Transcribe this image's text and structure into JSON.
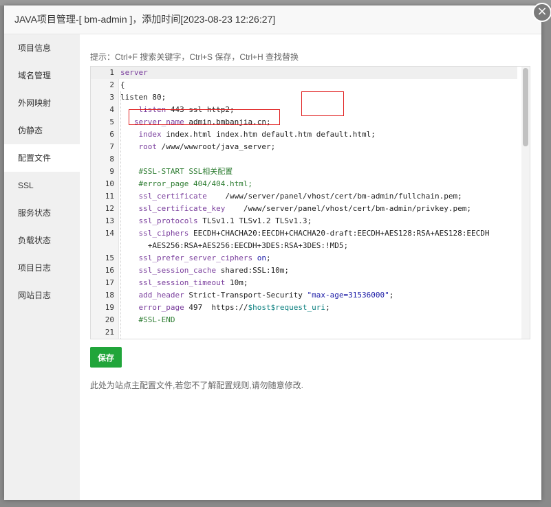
{
  "dialog": {
    "title": "JAVA项目管理-[ bm-admin ]，添加时间[2023-08-23 12:26:27]",
    "close_glyph": "×"
  },
  "sidebar": {
    "items": [
      {
        "label": "项目信息"
      },
      {
        "label": "域名管理"
      },
      {
        "label": "外网映射"
      },
      {
        "label": "伪静态"
      },
      {
        "label": "配置文件"
      },
      {
        "label": "SSL"
      },
      {
        "label": "服务状态"
      },
      {
        "label": "负载状态"
      },
      {
        "label": "项目日志"
      },
      {
        "label": "网站日志"
      }
    ],
    "active": "配置文件"
  },
  "main": {
    "hint": "提示：Ctrl+F 搜索关键字，Ctrl+S 保存，Ctrl+H 查找替换",
    "save_label": "保存",
    "note": "此处为站点主配置文件,若您不了解配置规则,请勿随意修改."
  },
  "editor": {
    "lines": [
      {
        "n": "1",
        "text": "server"
      },
      {
        "n": "2",
        "text": "{"
      },
      {
        "n": "3",
        "text": "listen 80;"
      },
      {
        "n": "4",
        "text": "    listen 443 ssl http2;"
      },
      {
        "n": "5",
        "text": "   server_name admin.bmbanjia.cn;"
      },
      {
        "n": "6",
        "text": "    index index.html index.htm default.htm default.html;"
      },
      {
        "n": "7",
        "text": "    root /www/wwwroot/java_server;"
      },
      {
        "n": "8",
        "text": ""
      },
      {
        "n": "9",
        "text": "    #SSL-START SSL相关配置"
      },
      {
        "n": "10",
        "text": "    #error_page 404/404.html;"
      },
      {
        "n": "11",
        "text": "    ssl_certificate    /www/server/panel/vhost/cert/bm-admin/fullchain.pem;"
      },
      {
        "n": "12",
        "text": "    ssl_certificate_key    /www/server/panel/vhost/cert/bm-admin/privkey.pem;"
      },
      {
        "n": "13",
        "text": "    ssl_protocols TLSv1.1 TLSv1.2 TLSv1.3;"
      },
      {
        "n": "14",
        "text": "    ssl_ciphers EECDH+CHACHA20:EECDH+CHACHA20-draft:EECDH+AES128:RSA+AES128:EECDH"
      },
      {
        "n": "",
        "text": "      +AES256:RSA+AES256:EECDH+3DES:RSA+3DES:!MD5;"
      },
      {
        "n": "15",
        "text": "    ssl_prefer_server_ciphers on;"
      },
      {
        "n": "16",
        "text": "    ssl_session_cache shared:SSL:10m;"
      },
      {
        "n": "17",
        "text": "    ssl_session_timeout 10m;"
      },
      {
        "n": "18",
        "text": "    add_header Strict-Transport-Security \"max-age=31536000\";"
      },
      {
        "n": "19",
        "text": "    error_page 497  https://$host$request_uri;"
      },
      {
        "n": "20",
        "text": "    #SSL-END"
      },
      {
        "n": "21",
        "text": ""
      }
    ]
  },
  "colors": {
    "save_button": "#20a53a",
    "highlight_box": "#e02020",
    "keyword": "#7a3e9d",
    "comment": "#2e7d32",
    "string": "#1a1aa6",
    "variable": "#0b7f7f"
  }
}
